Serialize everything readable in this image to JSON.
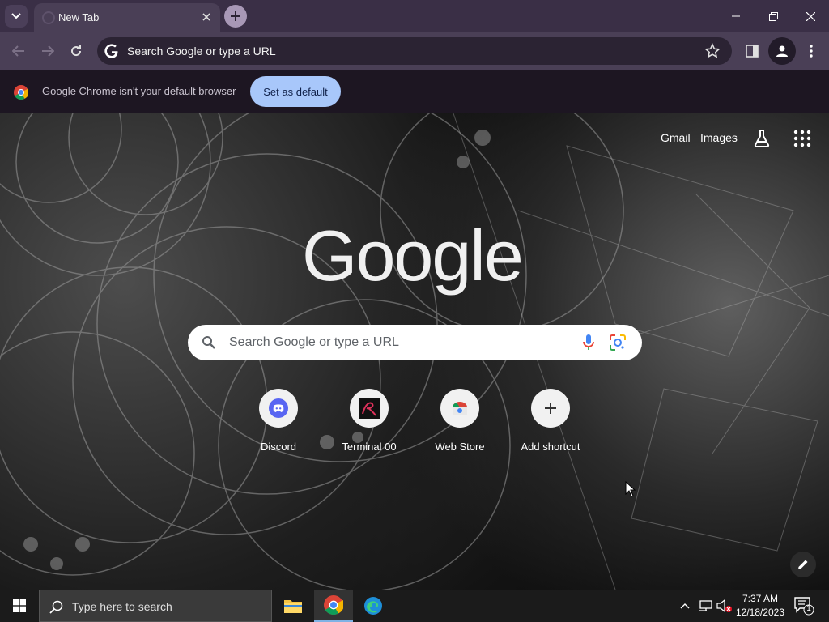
{
  "browser": {
    "tab_title": "New Tab",
    "omnibox_text": "Search Google or type a URL",
    "infobar_text": "Google Chrome isn't your default browser",
    "set_default_label": "Set as default"
  },
  "ntp": {
    "links": [
      "Gmail",
      "Images"
    ],
    "logo_text": "Google",
    "search_placeholder": "Search Google or type a URL",
    "shortcuts": [
      {
        "label": "Discord",
        "icon": "discord-icon"
      },
      {
        "label": "Terminal 00",
        "icon": "terminal-00-icon"
      },
      {
        "label": "Web Store",
        "icon": "web-store-icon"
      },
      {
        "label": "Add shortcut",
        "icon": "plus-icon"
      }
    ]
  },
  "taskbar": {
    "search_placeholder": "Type here to search",
    "time": "7:37 AM",
    "date": "12/18/2023",
    "notification_count": "1"
  },
  "colors": {
    "tab_strip": "#3a2f46",
    "toolbar": "#4a3f56",
    "set_default_button": "#a8c7fa",
    "taskbar": "#1b1b1b"
  }
}
